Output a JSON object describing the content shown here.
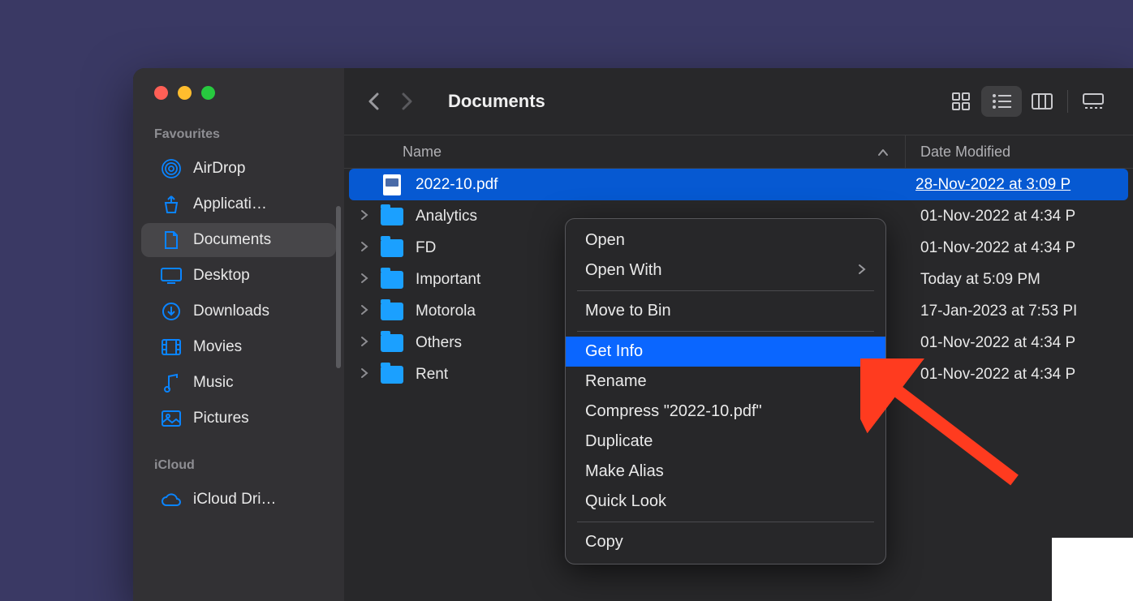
{
  "window": {
    "title": "Documents"
  },
  "sidebar": {
    "sections": [
      {
        "header": "Favourites",
        "items": [
          {
            "label": "AirDrop",
            "icon": "airdrop",
            "active": false
          },
          {
            "label": "Applicati…",
            "icon": "applications",
            "active": false
          },
          {
            "label": "Documents",
            "icon": "document",
            "active": true
          },
          {
            "label": "Desktop",
            "icon": "desktop",
            "active": false
          },
          {
            "label": "Downloads",
            "icon": "downloads",
            "active": false
          },
          {
            "label": "Movies",
            "icon": "movies",
            "active": false
          },
          {
            "label": "Music",
            "icon": "music",
            "active": false
          },
          {
            "label": "Pictures",
            "icon": "pictures",
            "active": false
          }
        ]
      },
      {
        "header": "iCloud",
        "items": [
          {
            "label": "iCloud Dri…",
            "icon": "icloud",
            "active": false
          }
        ]
      }
    ]
  },
  "columns": {
    "name": "Name",
    "date": "Date Modified"
  },
  "files": [
    {
      "name": "2022-10.pdf",
      "type": "pdf",
      "date": "28-Nov-2022 at 3:09 P",
      "selected": true,
      "expandable": false
    },
    {
      "name": "Analytics",
      "type": "folder",
      "date": "01-Nov-2022 at 4:34 P",
      "selected": false,
      "expandable": true
    },
    {
      "name": "FD",
      "type": "folder",
      "date": "01-Nov-2022 at 4:34 P",
      "selected": false,
      "expandable": true
    },
    {
      "name": "Important",
      "type": "folder",
      "date": "Today at 5:09 PM",
      "selected": false,
      "expandable": true
    },
    {
      "name": "Motorola",
      "type": "folder",
      "date": "17-Jan-2023 at 7:53 PI",
      "selected": false,
      "expandable": true
    },
    {
      "name": "Others",
      "type": "folder",
      "date": "01-Nov-2022 at 4:34 P",
      "selected": false,
      "expandable": true
    },
    {
      "name": "Rent",
      "type": "folder",
      "date": "01-Nov-2022 at 4:34 P",
      "selected": false,
      "expandable": true
    }
  ],
  "context_menu": {
    "items": [
      {
        "label": "Open",
        "type": "item"
      },
      {
        "label": "Open With",
        "type": "submenu"
      },
      {
        "type": "separator"
      },
      {
        "label": "Move to Bin",
        "type": "item"
      },
      {
        "type": "separator"
      },
      {
        "label": "Get Info",
        "type": "item",
        "highlighted": true
      },
      {
        "label": "Rename",
        "type": "item"
      },
      {
        "label": "Compress \"2022-10.pdf\"",
        "type": "item"
      },
      {
        "label": "Duplicate",
        "type": "item"
      },
      {
        "label": "Make Alias",
        "type": "item"
      },
      {
        "label": "Quick Look",
        "type": "item"
      },
      {
        "type": "separator"
      },
      {
        "label": "Copy",
        "type": "item"
      }
    ]
  }
}
